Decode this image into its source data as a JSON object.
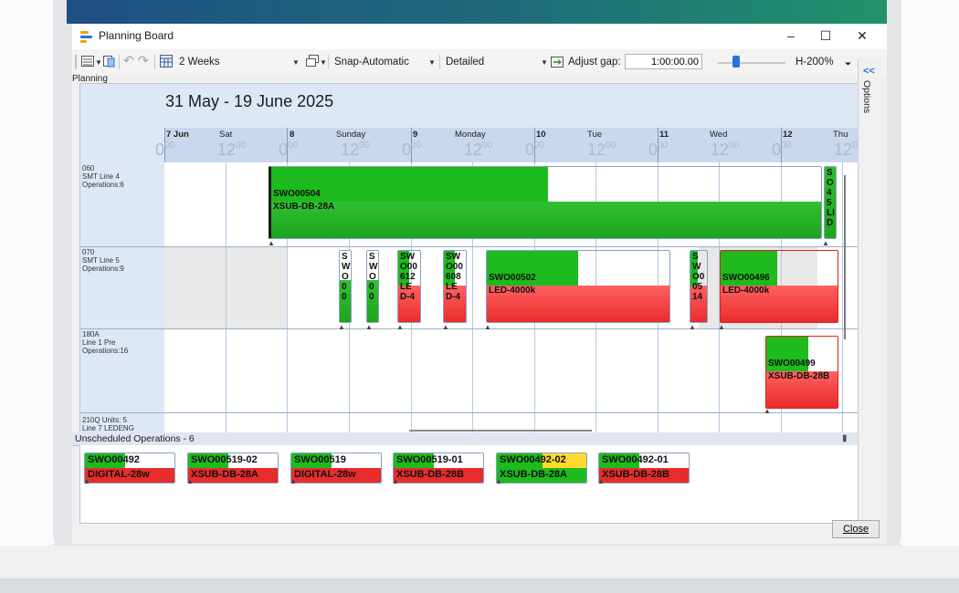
{
  "window": {
    "title": "Planning Board",
    "controls": [
      "–",
      "☐",
      "✕"
    ]
  },
  "toolbar": {
    "period": "2 Weeks",
    "snap": "Snap-Automatic",
    "detail": "Detailed",
    "adjust_gap_label": "Adjust gap:",
    "adjust_gap_value": "1:00:00.00",
    "zoom_label": "H-200%"
  },
  "planning": {
    "label": "Planning",
    "date_range": "31 May - 19 June 2025",
    "days": [
      {
        "num": "7 Jun",
        "name": "Sat"
      },
      {
        "num": "8",
        "name": "Sunday"
      },
      {
        "num": "9",
        "name": "Monday"
      },
      {
        "num": "10",
        "name": "Tue"
      },
      {
        "num": "11",
        "name": "Wed"
      },
      {
        "num": "12",
        "name": "Thu"
      }
    ],
    "hour_major": "0",
    "hour_major_sup": "00",
    "hour_mid": "12",
    "hour_mid_sup": "00",
    "rows": [
      {
        "code": "060",
        "name": "SMT Line 4",
        "ops": "Operations:6"
      },
      {
        "code": "070",
        "name": "SMT Line 5",
        "ops": "Operations:9"
      },
      {
        "code": "180A",
        "name": "Line 1 Pre",
        "ops": "Operations:16"
      },
      {
        "code": "210Q Units: 5",
        "name": "Line 7 LEDENG",
        "ops": ""
      }
    ],
    "ops": {
      "row1_main": {
        "l1": "SWO00504",
        "l2": "XSUB-DB-28A"
      },
      "row1_right": {
        "t": "S O 45 LI D"
      },
      "r2_a": {
        "t": "S W O 0 0"
      },
      "r2_b": {
        "t": "S W O 0 0"
      },
      "r2_c": {
        "t": "SW O00 612 LE D-4"
      },
      "r2_d": {
        "t": "SW O00 608 LE D-4"
      },
      "r2_e": {
        "l1": "SWO00502",
        "l2": "LED-4000k"
      },
      "r2_f": {
        "t": "S W O0 05 14"
      },
      "r2_g": {
        "l1": "SWO00496",
        "l2": "LED-4000k"
      },
      "r3_a": {
        "l1": "SWO00499",
        "l2": "XSUB-DB-28B"
      }
    }
  },
  "unscheduled": {
    "title": "Unscheduled Operations - 6",
    "cards": [
      {
        "l1": "SWO00492",
        "l2": "DIGITAL-28w"
      },
      {
        "l1": "SWO00519-02",
        "l2": "XSUB-DB-28A"
      },
      {
        "l1": "SWO00519",
        "l2": "DIGITAL-28w"
      },
      {
        "l1": "SWO00519-01",
        "l2": "XSUB-DB-28B"
      },
      {
        "l1": "SWO00492-02",
        "l2": "XSUB-DB-28A"
      },
      {
        "l1": "SWO00492-01",
        "l2": "XSUB-DB-28B"
      }
    ]
  },
  "options_label": "Options",
  "options_chevron": "<<",
  "close_label": "Close",
  "colors": {
    "green": "#1dbb1d",
    "red": "#e82c2c",
    "yellow": "#ffd92e",
    "accent": "#2873d8"
  }
}
